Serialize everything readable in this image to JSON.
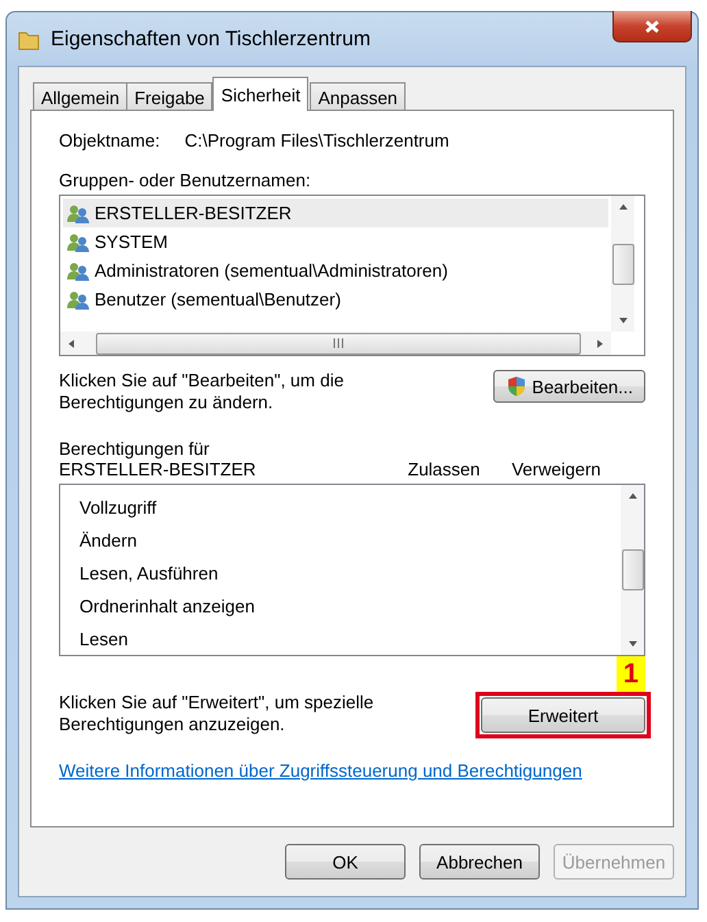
{
  "window": {
    "title": "Eigenschaften von Tischlerzentrum"
  },
  "tabs": [
    {
      "label": "Allgemein",
      "selected": false
    },
    {
      "label": "Freigabe",
      "selected": false
    },
    {
      "label": "Sicherheit",
      "selected": true
    },
    {
      "label": "Anpassen",
      "selected": false
    }
  ],
  "object_name": {
    "label": "Objektname:",
    "value": "C:\\Program Files\\Tischlerzentrum"
  },
  "groups": {
    "label": "Gruppen- oder Benutzernamen:",
    "items": [
      {
        "name": "ERSTELLER-BESITZER",
        "selected": true
      },
      {
        "name": "SYSTEM",
        "selected": false
      },
      {
        "name": "Administratoren (sementual\\Administratoren)",
        "selected": false
      },
      {
        "name": "Benutzer (sementual\\Benutzer)",
        "selected": false
      }
    ]
  },
  "edit_hint": "Klicken Sie auf \"Bearbeiten\", um die Berechtigungen zu ändern.",
  "edit_button": "Bearbeiten...",
  "permissions": {
    "label": "Berechtigungen für",
    "user": "ERSTELLER-BESITZER",
    "columns": [
      "Zulassen",
      "Verweigern"
    ],
    "rows": [
      "Vollzugriff",
      "Ändern",
      "Lesen, Ausführen",
      "Ordnerinhalt anzeigen",
      "Lesen"
    ]
  },
  "advanced_hint": "Klicken Sie auf \"Erweitert\", um spezielle Berechtigungen anzuzeigen.",
  "advanced_button": {
    "label": "Erweitert",
    "highlighted": true,
    "annotation": "1"
  },
  "link": "Weitere Informationen über Zugriffssteuerung und Berechtigungen",
  "buttons": [
    {
      "label": "OK",
      "disabled": false
    },
    {
      "label": "Abbrechen",
      "disabled": false
    },
    {
      "label": "Übernehmen",
      "disabled": true
    }
  ]
}
